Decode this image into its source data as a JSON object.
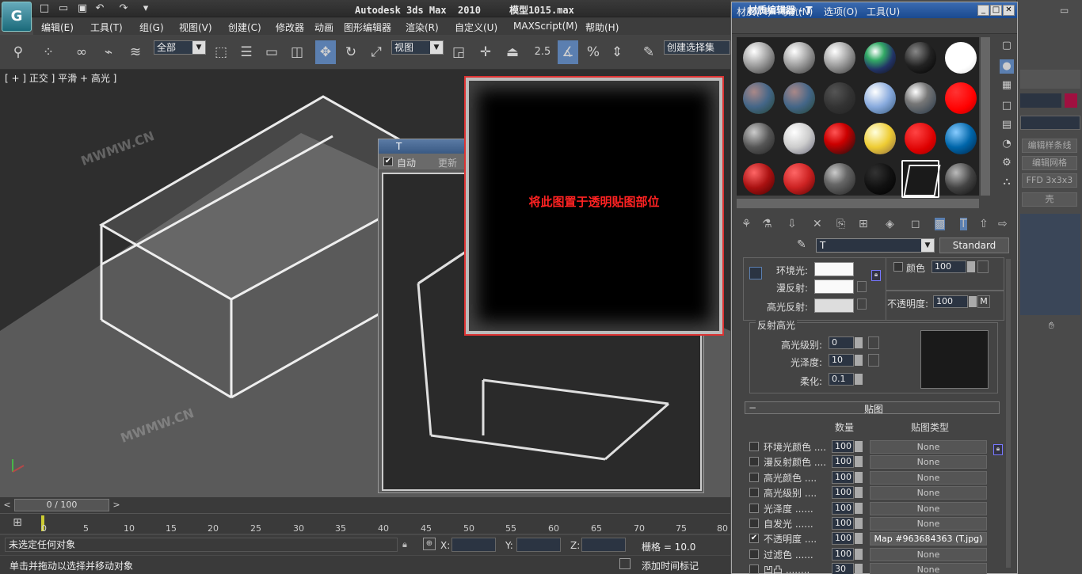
{
  "window": {
    "title": "Autodesk 3ds Max  2010     模型1015.max"
  },
  "menu": [
    "编辑(E)",
    "工具(T)",
    "组(G)",
    "视图(V)",
    "创建(C)",
    "修改器",
    "动画",
    "图形编辑器",
    "渲染(R)",
    "自定义(U)",
    "MAXScript(M)",
    "帮助(H)"
  ],
  "toolbar": {
    "selection_filter": "全部",
    "ref_coord": "视图",
    "snap_value": "2.5",
    "named_selection": "创建选择集"
  },
  "viewport": {
    "label": "[ + ] 正交 ] 平滑 + 高光 ]",
    "watermark1": "MWMW.CN",
    "watermark2": "MWMW.CN"
  },
  "render_window": {
    "title": "T",
    "auto_label": "自动",
    "update_label": "更新"
  },
  "popup": {
    "message": "将此图置于透明贴图部位"
  },
  "timeline": {
    "slider": "0 / 100",
    "ticks": [
      "0",
      "5",
      "10",
      "15",
      "20",
      "25",
      "30",
      "35",
      "40",
      "45",
      "50",
      "55",
      "60",
      "65",
      "70",
      "75",
      "80"
    ]
  },
  "status": {
    "line1": "未选定任何对象",
    "line2": "单击并拖动以选择并移动对象",
    "x_label": "X:",
    "y_label": "Y:",
    "z_label": "Z:",
    "grid": "栅格 = 10.0",
    "add_time_tag": "添加时间标记"
  },
  "cmd_panel": {
    "items": [
      "编辑样条线",
      "编辑网格",
      "FFD 3x3x3",
      "壳"
    ]
  },
  "material_editor": {
    "title": "材质编辑器 - T",
    "menus": [
      "材质(M)",
      "导航(N)",
      "选项(O)",
      "工具(U)"
    ],
    "material_name": "T",
    "material_type": "Standard",
    "params": {
      "ambient_label": "环境光:",
      "diffuse_label": "漫反射:",
      "specular_label": "高光反射:",
      "color_label": "颜色",
      "color_value": "100",
      "opacity_label": "不透明度:",
      "opacity_value": "100",
      "m_button": "M"
    },
    "specular": {
      "group_title": "反射高光",
      "level_label": "高光级别:",
      "level_value": "0",
      "gloss_label": "光泽度:",
      "gloss_value": "10",
      "soften_label": "柔化:",
      "soften_value": "0.1"
    },
    "maps": {
      "rollout_title": "贴图",
      "col_amount": "数量",
      "col_type": "贴图类型",
      "rows": [
        {
          "label": "环境光颜色 ....",
          "amount": "100",
          "map": "None",
          "checked": false
        },
        {
          "label": "漫反射颜色 ....",
          "amount": "100",
          "map": "None",
          "checked": false
        },
        {
          "label": "高光颜色 ....",
          "amount": "100",
          "map": "None",
          "checked": false
        },
        {
          "label": "高光级别 ....",
          "amount": "100",
          "map": "None",
          "checked": false
        },
        {
          "label": "光泽度 ......",
          "amount": "100",
          "map": "None",
          "checked": false
        },
        {
          "label": "自发光 ......",
          "amount": "100",
          "map": "None",
          "checked": false
        },
        {
          "label": "不透明度 ....",
          "amount": "100",
          "map": "Map #963684363 (T.jpg)",
          "checked": true
        },
        {
          "label": "过滤色 ......",
          "amount": "100",
          "map": "None",
          "checked": false
        },
        {
          "label": "凹凸 ........",
          "amount": "30",
          "map": "None",
          "checked": false
        }
      ]
    }
  }
}
